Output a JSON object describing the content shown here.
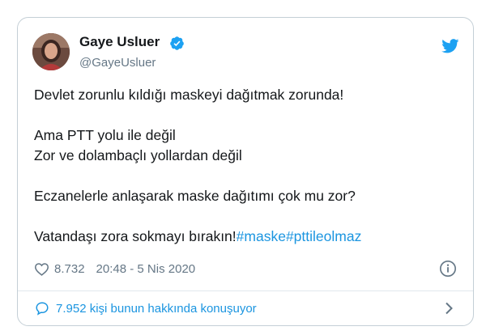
{
  "author": {
    "display_name": "Gaye Usluer",
    "handle": "@GayeUsluer",
    "verified": true
  },
  "tweet": {
    "lines": [
      "Devlet zorunlu kıldığı maskeyi dağıtmak zorunda!",
      "Ama PTT yolu ile değil",
      "Zor ve dolambaçlı yollardan değil",
      "Eczanelerle anlaşarak maske dağıtımı çok mu zor?",
      "Vatandaşı zora sokmayı bırakın!"
    ],
    "hashtags": [
      "#maske",
      "#pttileolmaz"
    ]
  },
  "meta": {
    "likes": "8.732",
    "timestamp": "20:48 - 5 Nis 2020"
  },
  "conversation": {
    "label": "7.952 kişi bunun hakkında konuşuyor"
  },
  "icons": {
    "verified": "verified-badge-icon",
    "brand": "twitter-bird-icon",
    "like": "heart-icon",
    "info": "info-icon",
    "reply": "speech-bubble-icon",
    "chevron": "chevron-right-icon"
  },
  "colors": {
    "accent": "#1b95e0",
    "twitter_blue": "#1da1f2",
    "secondary_text": "#657786",
    "border": "#c4cfd6"
  }
}
